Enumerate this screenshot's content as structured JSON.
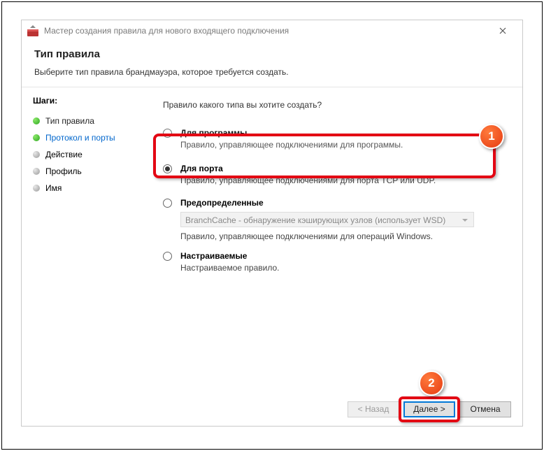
{
  "window": {
    "title": "Мастер создания правила для нового входящего подключения"
  },
  "header": {
    "title": "Тип правила",
    "subtitle": "Выберите тип правила брандмауэра, которое требуется создать."
  },
  "steps": {
    "title": "Шаги:",
    "items": [
      {
        "label": "Тип правила",
        "state": "current"
      },
      {
        "label": "Протокол и порты",
        "state": "link"
      },
      {
        "label": "Действие",
        "state": "pending"
      },
      {
        "label": "Профиль",
        "state": "pending"
      },
      {
        "label": "Имя",
        "state": "pending"
      }
    ]
  },
  "content": {
    "prompt": "Правило какого типа вы хотите создать?",
    "options": [
      {
        "label": "Для программы",
        "desc": "Правило, управляющее подключениями для программы.",
        "checked": false
      },
      {
        "label": "Для порта",
        "desc": "Правило, управляющее подключениями для порта TCP или UDP.",
        "checked": true
      },
      {
        "label": "Предопределенные",
        "desc": "Правило, управляющее подключениями для операций Windows.",
        "checked": false,
        "dropdown": "BranchCache - обнаружение кэширующих узлов (использует WSD)"
      },
      {
        "label": "Настраиваемые",
        "desc": "Настраиваемое правило.",
        "checked": false
      }
    ]
  },
  "footer": {
    "back": "< Назад",
    "next": "Далее >",
    "cancel": "Отмена"
  },
  "annotations": {
    "badge1": "1",
    "badge2": "2"
  }
}
